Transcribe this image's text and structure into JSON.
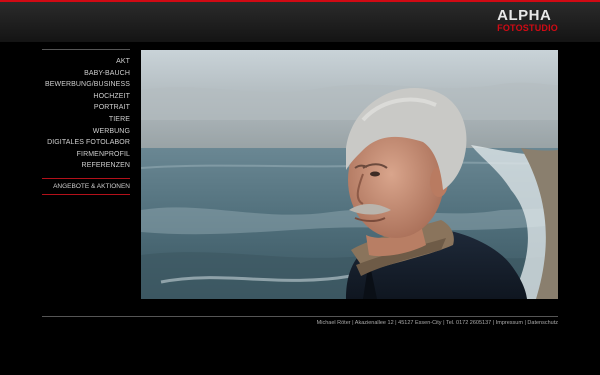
{
  "brand": {
    "name": "ALPHA",
    "sub": "FOTOSTUDIO",
    "accent": "#d10a14"
  },
  "nav": {
    "items": [
      {
        "label": "AKT"
      },
      {
        "label": "BABY-BAUCH"
      },
      {
        "label": "BEWERBUNG/BUSINESS"
      },
      {
        "label": "HOCHZEIT"
      },
      {
        "label": "PORTRAIT"
      },
      {
        "label": "TIERE"
      },
      {
        "label": "WERBUNG"
      },
      {
        "label": "DIGITALES FOTOLABOR"
      },
      {
        "label": "FIRMENPROFIL"
      },
      {
        "label": "REFERENZEN"
      }
    ],
    "special": "ANGEBOTE & AKTIONEN"
  },
  "footer": {
    "name": "Michael Röter",
    "street": "Akazienallee 12",
    "city": "45127 Essen-City",
    "phone": "Tel. 0172 2605137",
    "impressum": "Impressum",
    "datenschutz": "Datenschutz",
    "separator": " | "
  }
}
